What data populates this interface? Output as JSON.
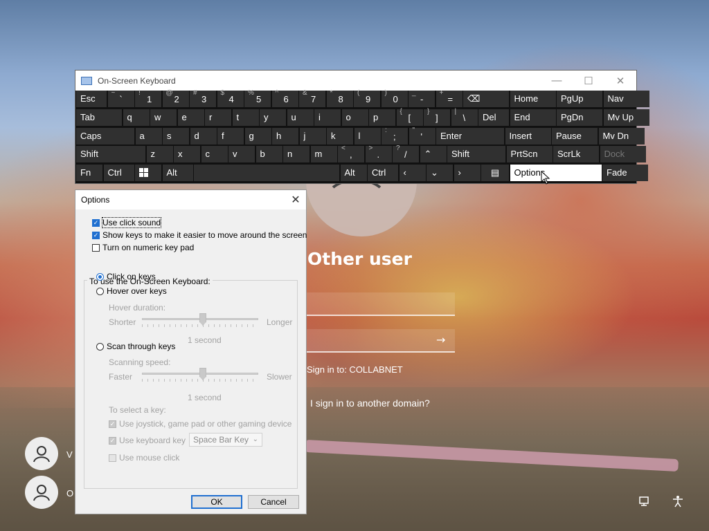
{
  "colors": {
    "osk_bg": "#111111",
    "key_bg": "#303030",
    "key_highlight": "#ffffff",
    "accent": "#1f6fd0",
    "dialog_bg": "#f0f0f0"
  },
  "osk": {
    "title": "On-Screen Keyboard",
    "icon": "keyboard-icon",
    "window_controls": [
      "minimize-icon",
      "maximize-icon",
      "close-icon"
    ],
    "rows": [
      [
        {
          "main": "Esc"
        },
        {
          "shift": "~",
          "main": "`"
        },
        {
          "shift": "!",
          "main": "1"
        },
        {
          "shift": "@",
          "main": "2"
        },
        {
          "shift": "#",
          "main": "3"
        },
        {
          "shift": "$",
          "main": "4"
        },
        {
          "shift": "%",
          "main": "5"
        },
        {
          "shift": "^",
          "main": "6"
        },
        {
          "shift": "&",
          "main": "7"
        },
        {
          "shift": "*",
          "main": "8"
        },
        {
          "shift": "(",
          "main": "9"
        },
        {
          "shift": ")",
          "main": "0"
        },
        {
          "shift": "_",
          "main": "-"
        },
        {
          "shift": "+",
          "main": "="
        },
        {
          "main": "⌫"
        },
        {
          "main": "Home"
        },
        {
          "main": "PgUp"
        },
        {
          "main": "Nav"
        }
      ],
      [
        {
          "main": "Tab"
        },
        {
          "main": "q"
        },
        {
          "main": "w"
        },
        {
          "main": "e"
        },
        {
          "main": "r"
        },
        {
          "main": "t"
        },
        {
          "main": "y"
        },
        {
          "main": "u"
        },
        {
          "main": "i"
        },
        {
          "main": "o"
        },
        {
          "main": "p"
        },
        {
          "shift": "{",
          "main": "["
        },
        {
          "shift": "}",
          "main": "]"
        },
        {
          "shift": "|",
          "main": "\\"
        },
        {
          "main": "Del"
        },
        {
          "main": "End"
        },
        {
          "main": "PgDn"
        },
        {
          "main": "Mv Up"
        }
      ],
      [
        {
          "main": "Caps"
        },
        {
          "main": "a"
        },
        {
          "main": "s"
        },
        {
          "main": "d"
        },
        {
          "main": "f"
        },
        {
          "main": "g"
        },
        {
          "main": "h"
        },
        {
          "main": "j"
        },
        {
          "main": "k"
        },
        {
          "main": "l"
        },
        {
          "shift": ":",
          "main": ";"
        },
        {
          "shift": "\"",
          "main": "'"
        },
        {
          "main": "Enter"
        },
        {
          "main": "Insert"
        },
        {
          "main": "Pause"
        },
        {
          "main": "Mv Dn"
        }
      ],
      [
        {
          "main": "Shift"
        },
        {
          "main": "z"
        },
        {
          "main": "x"
        },
        {
          "main": "c"
        },
        {
          "main": "v"
        },
        {
          "main": "b"
        },
        {
          "main": "n"
        },
        {
          "main": "m"
        },
        {
          "shift": "<",
          "main": ","
        },
        {
          "shift": ">",
          "main": "."
        },
        {
          "shift": "?",
          "main": "/"
        },
        {
          "main": "⌃"
        },
        {
          "main": "Shift"
        },
        {
          "main": "PrtScn"
        },
        {
          "main": "ScrLk"
        },
        {
          "main": "Dock"
        }
      ],
      [
        {
          "main": "Fn"
        },
        {
          "main": "Ctrl"
        },
        {
          "main": "windows-icon"
        },
        {
          "main": "Alt"
        },
        {
          "main": ""
        },
        {
          "main": "Alt"
        },
        {
          "main": "Ctrl"
        },
        {
          "main": "‹"
        },
        {
          "main": "⌄"
        },
        {
          "main": "›"
        },
        {
          "main": "menu-icon"
        },
        {
          "main": "Options"
        },
        {
          "main": "Fade"
        }
      ]
    ]
  },
  "options": {
    "title": "Options",
    "use_click_sound": "Use click sound",
    "show_keys": "Show keys to make it easier to move around the screen",
    "numeric_pad": "Turn on numeric key pad",
    "group_label": "To use the On-Screen Keyboard:",
    "click_on_keys": "Click on keys",
    "hover_over_keys": "Hover over keys",
    "hover_duration": "Hover duration:",
    "shorter": "Shorter",
    "longer": "Longer",
    "hover_value": "1 second",
    "scan_through_keys": "Scan through keys",
    "scanning_speed": "Scanning speed:",
    "faster": "Faster",
    "slower": "Slower",
    "scan_value": "1 second",
    "to_select_key": "To select a key:",
    "use_joystick": "Use joystick, game pad or other gaming device",
    "use_keyboard_key": "Use keyboard key",
    "keyboard_key_value": "Space Bar Key",
    "use_mouse_click": "Use mouse click",
    "ok": "OK",
    "cancel": "Cancel",
    "state": {
      "click_sound": true,
      "show_keys": true,
      "numeric_pad": false,
      "mode": "click",
      "joystick": true,
      "keyboard_key": true,
      "mouse_click": false
    }
  },
  "login": {
    "title": "Other user",
    "sign_in_to": "Sign in to: COLLABNET",
    "other_domain": "I sign in to another domain?",
    "user1_name": "V",
    "user2_name": "O"
  }
}
